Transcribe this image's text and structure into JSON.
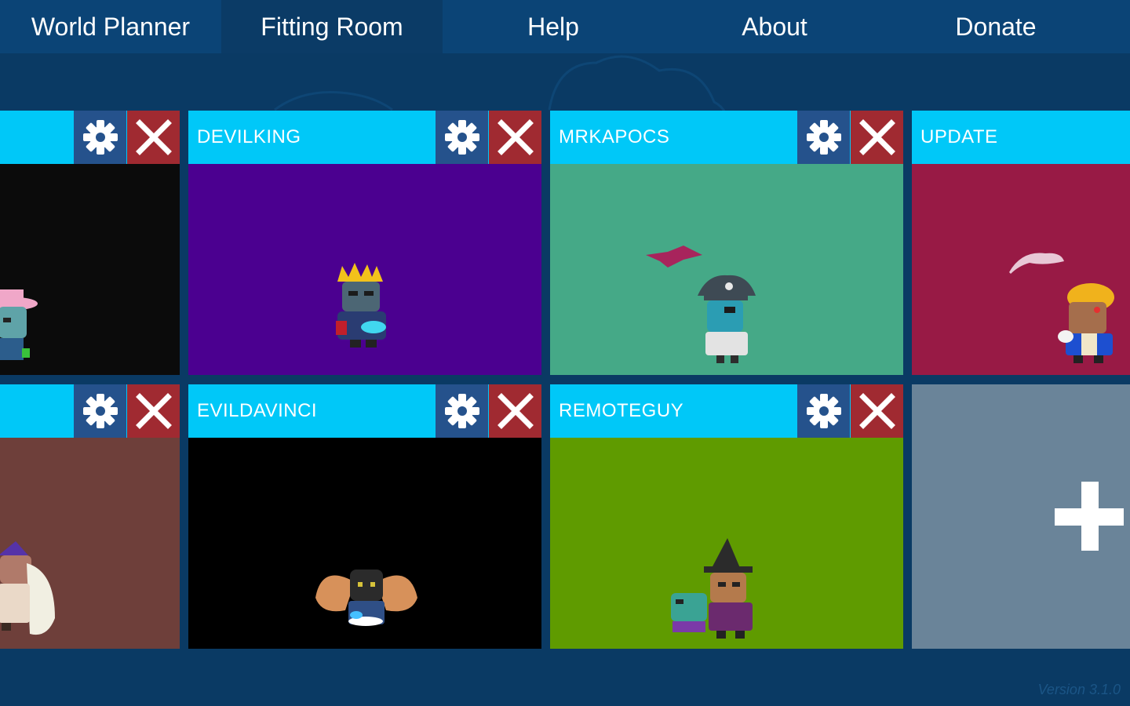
{
  "nav": {
    "tabs": [
      {
        "label": "World Planner"
      },
      {
        "label": "Fitting Room"
      },
      {
        "label": "Help"
      },
      {
        "label": "About"
      },
      {
        "label": "Donate"
      }
    ]
  },
  "cards": [
    {
      "title": "",
      "bg": "#0b0b0b"
    },
    {
      "title": "DEVILKING",
      "bg": "#4b0090"
    },
    {
      "title": "MRKAPOCS",
      "bg": "#45a987"
    },
    {
      "title": "UPDATE",
      "bg": "#981a45"
    },
    {
      "title": "",
      "bg": "#6e3f3a"
    },
    {
      "title": "EVILDAVINCI",
      "bg": "#000000"
    },
    {
      "title": "REMOTEGUY",
      "bg": "#5f9b00"
    }
  ],
  "icons": {
    "settings": "gear-icon",
    "delete": "close-icon",
    "add": "plus-icon"
  },
  "colors": {
    "nav_bg": "#0b4476",
    "card_header": "#00c8f8",
    "gear_button": "#25528c",
    "close_button": "#a02a31",
    "add_card": "#6a8499"
  },
  "footer": {
    "version": "Version 3.1.0"
  }
}
